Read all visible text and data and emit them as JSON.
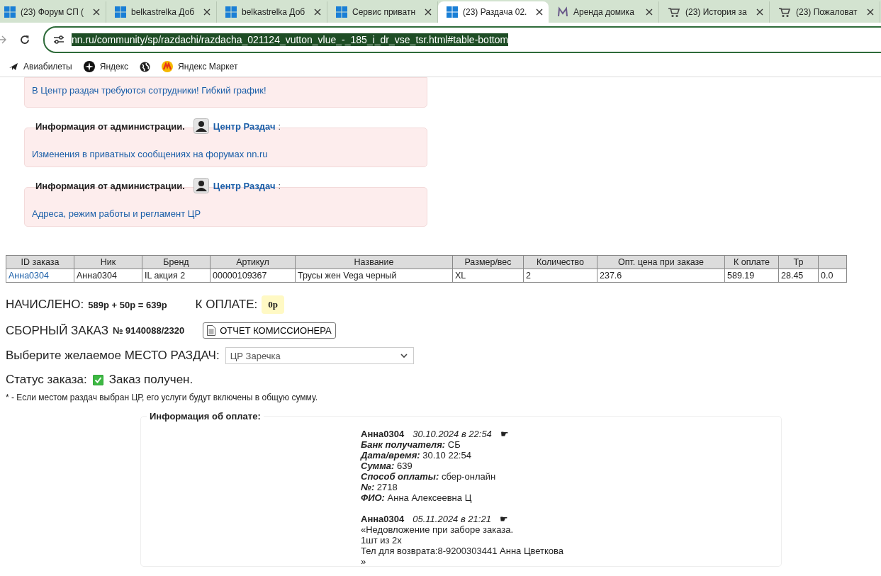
{
  "browser": {
    "tabs": [
      {
        "title": "(23) Форум СП (",
        "selected": false
      },
      {
        "title": "belkastrelka Доб",
        "selected": false
      },
      {
        "title": "belkastrelka Доб",
        "selected": false
      },
      {
        "title": "Сервис приватн",
        "selected": false
      },
      {
        "title": "(23) Раздача 02.",
        "selected": true
      },
      {
        "title": "Аренда домика",
        "selected": false
      },
      {
        "title": "(23) История за",
        "selected": false
      },
      {
        "title": "(23) Пожаловат",
        "selected": false
      }
    ],
    "url": "nn.ru/community/sp/razdachi/razdacha_021124_vutton_vlue_-_185_i_dr_vse_tsr.html#table-bottom",
    "bookmarks": [
      "Авиабилеты",
      "Яндекс",
      "Яндекс Маркет"
    ]
  },
  "notices": [
    {
      "text": "В Центр раздач требуются сотрудники! Гибкий график!"
    },
    {
      "header": "Информация от администрации.",
      "author": "Центр Раздач",
      "sep": ":",
      "text": "Изменения в приватных сообщениях на форумах nn.ru"
    },
    {
      "header": "Информация от администрации.",
      "author": "Центр Раздач",
      "sep": ":",
      "text": "Адреса, режим работы и регламент ЦР"
    }
  ],
  "table": {
    "columns": [
      "ID заказа",
      "Ник",
      "Бренд",
      "Артикул",
      "Название",
      "Размер/вес",
      "Количество",
      "Опт. цена при заказе",
      "К оплате",
      "Тр",
      ""
    ],
    "rows": [
      [
        "Анна0304",
        "Анна0304",
        "IL акция 2",
        "00000109367",
        "Трусы жен Vega черный",
        "XL",
        "2",
        "237.6",
        "589.19",
        "28.45",
        "0.0"
      ]
    ]
  },
  "accrued": {
    "label": "НАЧИСЛЕНО:",
    "value": "589р + 50р = 639р"
  },
  "to_pay": {
    "label": "К ОПЛАТЕ:",
    "value": "0р"
  },
  "order": {
    "label": "СБОРНЫЙ ЗАКАЗ",
    "number": "№ 9140088/2320",
    "report_button": "ОТЧЕТ КОМИССИОНЕРА"
  },
  "pickup": {
    "label": "Выберите желаемое МЕСТО РАЗДАЧ:",
    "value": "ЦР Заречка"
  },
  "status": {
    "label": "Статус заказа:",
    "checked": true,
    "text": "Заказ получен."
  },
  "footnote": "* - Если местом раздач выбран ЦР, его услуги будут включены в общую сумму.",
  "payment": {
    "legend": "Информация об оплате:",
    "entries": [
      {
        "kind": "fields",
        "author": "Анна0304",
        "date": "30.10.2024 в 22:54",
        "marker": "☛",
        "fields": [
          {
            "label": "Банк получателя:",
            "value": "СБ"
          },
          {
            "label": "Дата/время:",
            "value": "30.10 22:54"
          },
          {
            "label": "Сумма:",
            "value": "639"
          },
          {
            "label": "Способ оплаты:",
            "value": "сбер-онлайн"
          },
          {
            "label": "№:",
            "value": "2718"
          },
          {
            "label": "ФИО:",
            "value": "Анна Алексеевна Ц"
          }
        ]
      },
      {
        "kind": "message",
        "author": "Анна0304",
        "date": "05.11.2024 в 21:21",
        "marker": "☛",
        "lines": [
          "«Недовложение при заборе заказа.",
          "1шт из 2х",
          "Тел для возврата:8-9200303441 Анна Цветкова",
          "»"
        ]
      }
    ]
  }
}
